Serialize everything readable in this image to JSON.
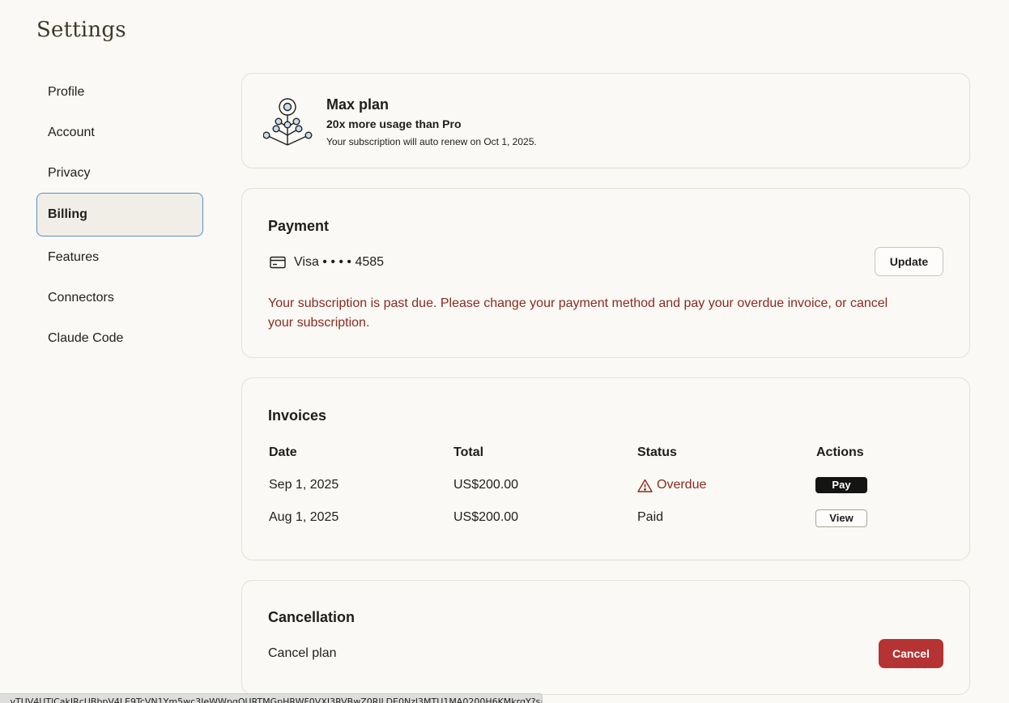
{
  "page": {
    "title": "Settings"
  },
  "sidebar": {
    "items": [
      {
        "label": "Profile",
        "active": false
      },
      {
        "label": "Account",
        "active": false
      },
      {
        "label": "Privacy",
        "active": false
      },
      {
        "label": "Billing",
        "active": true
      },
      {
        "label": "Features",
        "active": false
      },
      {
        "label": "Connectors",
        "active": false
      },
      {
        "label": "Claude Code",
        "active": false
      }
    ]
  },
  "plan": {
    "icon": "plant-branch-icon",
    "name": "Max plan",
    "tagline": "20x more usage than Pro",
    "renewal": "Your subscription will auto renew on Oct 1, 2025."
  },
  "payment": {
    "heading": "Payment",
    "card_icon": "credit-card-icon",
    "card_label": "Visa • • • • 4585",
    "update_label": "Update",
    "warning": "Your subscription is past due. Please change your payment method and pay your overdue invoice, or cancel your subscription.",
    "warning_color": "#8a2a1f"
  },
  "invoices": {
    "heading": "Invoices",
    "columns": [
      "Date",
      "Total",
      "Status",
      "Actions"
    ],
    "rows": [
      {
        "date": "Sep 1, 2025",
        "total": "US$200.00",
        "status": "Overdue",
        "status_icon": "warning-triangle-icon",
        "action": "Pay"
      },
      {
        "date": "Aug 1, 2025",
        "total": "US$200.00",
        "status": "Paid",
        "action": "View"
      }
    ]
  },
  "cancellation": {
    "heading": "Cancellation",
    "label": "Cancel plan",
    "button_label": "Cancel",
    "button_color": "#b53333"
  },
  "status_bar": {
    "url": "...vTUV4UTlCakIRcUBbpV4LE9TcVN1Ym5wc3JeWWpqOURTMGpHRWF0VXJ3RVBwZ0RlLDE0Nzl3MTU1MA0200H6KMkrqY?s=ap..."
  },
  "colors": {
    "background": "#faf9f5",
    "card_border": "#e3e0d6",
    "active_nav_bg": "#f0eee6",
    "active_nav_border": "#5b8fc7",
    "danger": "#b53333",
    "pay_button": "#141413"
  }
}
